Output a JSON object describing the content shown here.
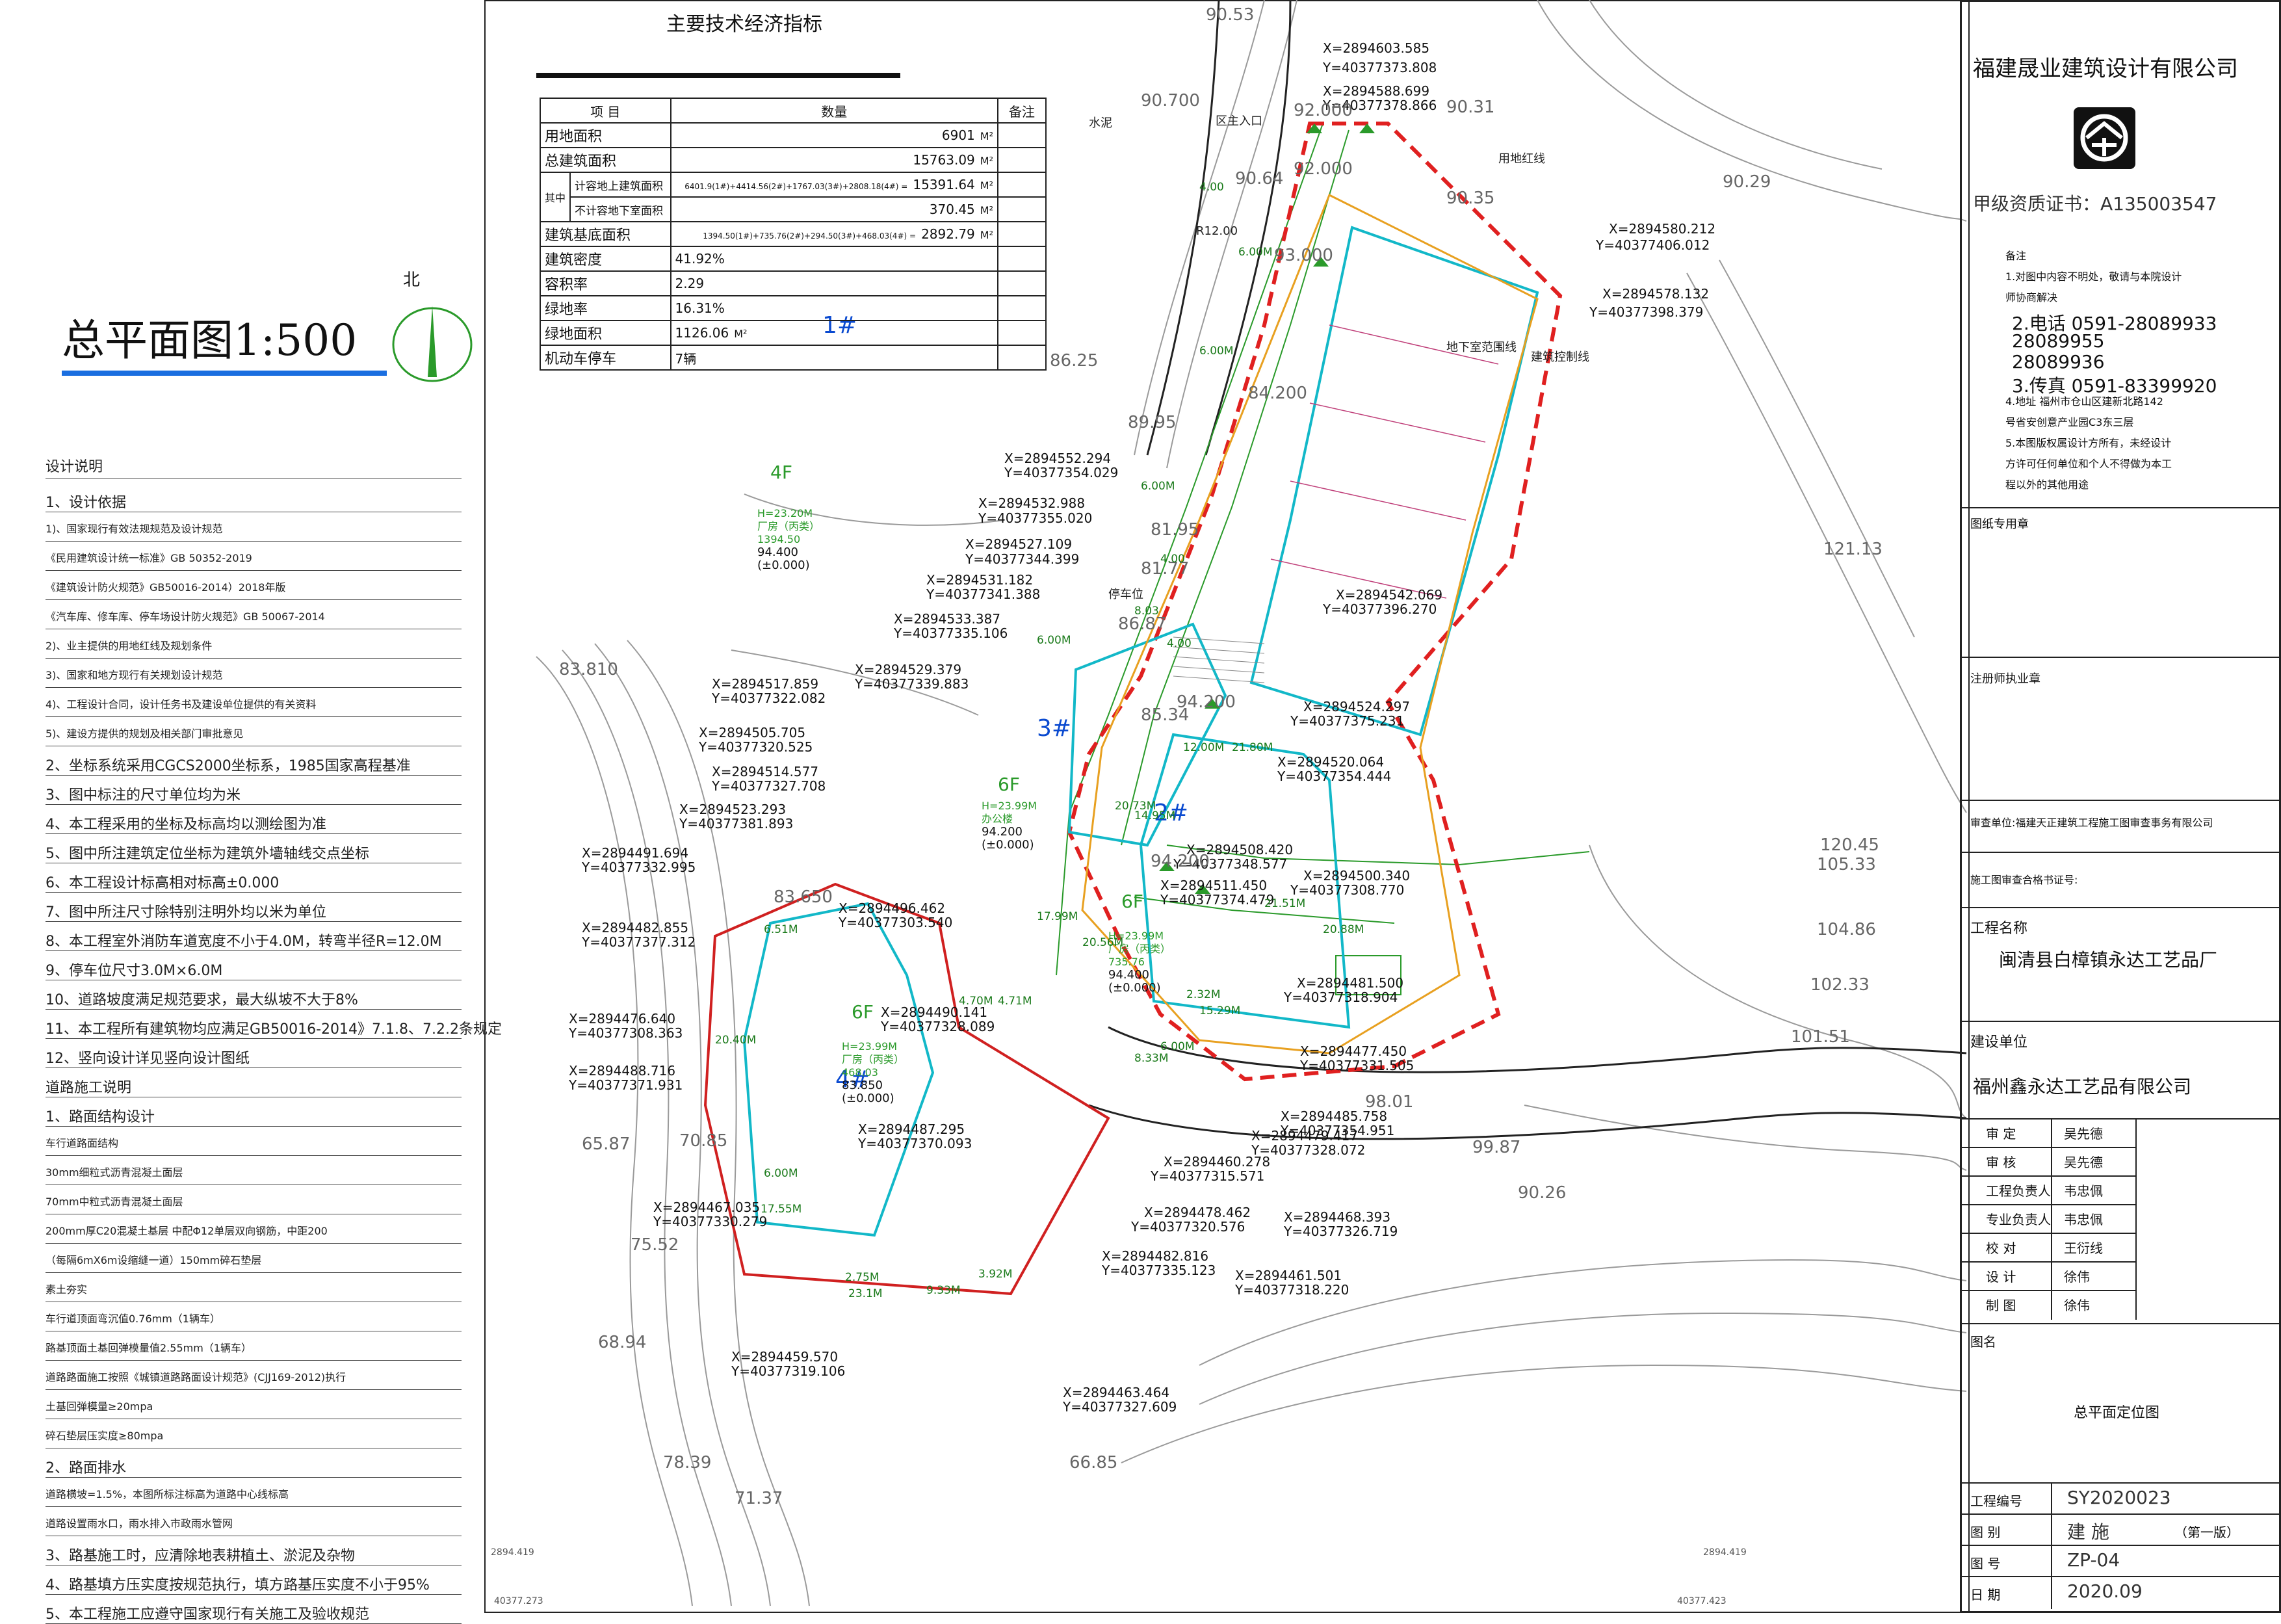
{
  "left": {
    "title": "总平面图1:500",
    "north": "北",
    "notes_heading": "设计说明",
    "notes": [
      "1、设计依据",
      "1)、国家现行有效法规规范及设计规范",
      "《民用建筑设计统一标准》GB 50352-2019",
      "《建筑设计防火规范》GB50016-2014）2018年版",
      "《汽车库、修车库、停车场设计防火规范》GB 50067-2014",
      "2)、业主提供的用地红线及规划条件",
      "3)、国家和地方现行有关规划设计规范",
      "4)、工程设计合同，设计任务书及建设单位提供的有关资料",
      "5)、建设方提供的规划及相关部门审批意见",
      "2、坐标系统采用CGCS2000坐标系，1985国家高程基准",
      "3、图中标注的尺寸单位均为米",
      "4、本工程采用的坐标及标高均以测绘图为准",
      "5、图中所注建筑定位坐标为建筑外墙轴线交点坐标",
      "6、本工程设计标高相对标高±0.000",
      "7、图中所注尺寸除特别注明外均以米为单位",
      "8、本工程室外消防车道宽度不小于4.0M，转弯半径R=12.0M",
      "9、停车位尺寸3.0M×6.0M",
      "10、道路坡度满足规范要求，最大纵坡不大于8%",
      "11、本工程所有建筑物均应满足GB50016-2014》7.1.8、7.2.2条规定",
      "12、竖向设计详见竖向设计图纸",
      "道路施工说明",
      "1、路面结构设计",
      "车行道路面结构",
      "30mm细粒式沥青混凝土面层",
      "70mm中粒式沥青混凝土面层",
      "200mm厚C20混凝土基层 中配Φ12单层双向钢筋，中距200",
      "（每隔6mX6m设缩缝一道）150mm碎石垫层",
      "素土夯实",
      "车行道顶面弯沉值0.76mm（1辆车）",
      "路基顶面土基回弹模量值2.55mm（1辆车）",
      "道路路面施工按照《城镇道路路面设计规范》(CJJ169-2012)执行",
      "土基回弹模量≥20mpa",
      "碎石垫层压实度≥80mpa",
      "2、路面排水",
      "道路横坡=1.5%，本图所标注标高为道路中心线标高",
      "道路设置雨水口，雨水排入市政雨水管网",
      "3、路基施工时，应清除地表耕植土、淤泥及杂物",
      "4、路基填方压实度按规范执行，填方路基压实度不小于95%",
      "5、本工程施工应遵守国家现行有关施工及验收规范"
    ]
  },
  "table": {
    "title": "主要技术经济指标",
    "headers": [
      "项 目",
      "数量",
      "备注"
    ],
    "rows": [
      {
        "label": "用地面积",
        "value": "6901",
        "unit": "M²"
      },
      {
        "label": "总建筑面积",
        "value": "15763.09",
        "unit": "M²"
      },
      {
        "label": "计容地上建筑面积",
        "value": "15391.64",
        "unit": "M²",
        "formula": "6401.9(1#)+4414.56(2#)+1767.03(3#)+2808.18(4#) ="
      },
      {
        "label": "不计容地下室面积",
        "value": "370.45",
        "unit": "M²"
      },
      {
        "label": "建筑基底面积",
        "value": "2892.79",
        "unit": "M²",
        "formula": "1394.50(1#)+735.76(2#)+294.50(3#)+468.03(4#) ="
      },
      {
        "label": "建筑密度",
        "value": "41.92%",
        "unit": ""
      },
      {
        "label": "容积率",
        "value": "2.29",
        "unit": ""
      },
      {
        "label": "绿地率",
        "value": "16.31%",
        "unit": ""
      },
      {
        "label": "绿地面积",
        "value": "1126.06",
        "unit": "M²"
      },
      {
        "label": "机动车停车",
        "value": "7辆",
        "unit": ""
      }
    ],
    "group_label": "其中"
  },
  "site": {
    "buildings": [
      {
        "id": "1#",
        "floors": "4F",
        "use": "厂房（丙类）",
        "height": "H=23.20M",
        "area": "1394.50",
        "elev": "94.400",
        "zero": "(±0.000)"
      },
      {
        "id": "2#",
        "floors": "6F",
        "use": "厂房（丙类）",
        "height": "H=23.99M",
        "area": "735.76",
        "elev": "94.400",
        "zero": "(±0.000)"
      },
      {
        "id": "3#",
        "floors": "6F",
        "use": "办公楼",
        "height": "H=23.99M",
        "area": "",
        "elev": "94.200",
        "zero": "(±0.000)"
      },
      {
        "id": "4#",
        "floors": "6F",
        "use": "厂房（丙类）",
        "height": "H=23.99M",
        "area": "468.03",
        "elev": "83.850",
        "zero": "(±0.000)"
      }
    ],
    "labels": {
      "redline": "用地红线",
      "buildline": "建筑控制线",
      "cement": "水泥",
      "entrance": "区主入口",
      "basement": "地下室范围线",
      "parking": "停车位",
      "road_r": "R12.00"
    },
    "coords": [
      "X=2894603.585",
      "Y=40377373.808",
      "X=2894588.699",
      "Y=40377378.866",
      "X=2894580.212",
      "Y=40377406.012",
      "X=2894578.132",
      "Y=40377398.379",
      "X=2894552.294",
      "Y=40377354.029",
      "X=2894532.988",
      "Y=40377355.020",
      "X=2894527.109",
      "Y=40377344.399",
      "X=2894531.182",
      "Y=40377341.388",
      "X=2894533.387",
      "Y=40377335.106",
      "X=2894542.069",
      "Y=40377396.270",
      "X=2894529.379",
      "Y=40377339.883",
      "X=2894517.859",
      "Y=40377322.082",
      "X=2894505.705",
      "Y=40377320.525",
      "X=2894514.577",
      "Y=40377327.708",
      "X=2894523.293",
      "Y=40377381.893",
      "X=2894524.297",
      "Y=40377375.231",
      "X=2894520.064",
      "Y=40377354.444",
      "X=2894508.420",
      "Y=40377348.577",
      "X=2894511.450",
      "Y=40377374.479",
      "X=2894500.340",
      "Y=40377308.770",
      "X=2894491.694",
      "Y=40377332.995",
      "X=2894496.462",
      "Y=40377303.540",
      "X=2894482.855",
      "Y=40377377.312",
      "X=2894481.500",
      "Y=40377318.904",
      "X=2894490.141",
      "Y=40377328.089",
      "X=2894476.640",
      "Y=40377308.363",
      "X=2894488.716",
      "Y=40377371.931",
      "X=2894477.450",
      "Y=40377331.505",
      "X=2894487.295",
      "Y=40377370.093",
      "X=2894485.758",
      "Y=40377354.951",
      "X=2894479.417",
      "Y=40377328.072",
      "X=2894460.278",
      "Y=40377315.571",
      "X=2894467.035",
      "Y=40377330.279",
      "X=2894478.462",
      "Y=40377320.576",
      "X=2894468.393",
      "Y=40377326.719",
      "X=2894482.816",
      "Y=40377335.123",
      "X=2894461.501",
      "Y=40377318.220",
      "X=2894459.570",
      "Y=40377319.106",
      "X=2894463.464",
      "Y=40377327.609"
    ],
    "elevations": [
      "90.53",
      "90.700",
      "92.000",
      "92.000",
      "93.000",
      "90.31",
      "90.35",
      "90.29",
      "90.64",
      "86.25",
      "89.95",
      "81.95",
      "81.77",
      "86.87",
      "83.810",
      "85.34",
      "84.200",
      "94.200",
      "94.200",
      "83.650",
      "121.13",
      "120.45",
      "102.33",
      "101.51",
      "104.86",
      "105.33",
      "98.01",
      "99.87",
      "90.26",
      "75.52",
      "70.85",
      "65.87",
      "68.94",
      "78.39",
      "71.37",
      "66.85"
    ],
    "dims": [
      "4.00",
      "6.00M",
      "6.00M",
      "6.00M",
      "4.00",
      "8.03",
      "6.00M",
      "12.00M",
      "21.80M",
      "20.73M",
      "14.95M",
      "17.99M",
      "20.56M",
      "21.51M",
      "20.88M",
      "15.29M",
      "8.33M",
      "4.71M",
      "2.32M",
      "6.00M",
      "6.51M",
      "20.40M",
      "17.55M",
      "6.00M",
      "23.1M",
      "2.75M",
      "9.33M",
      "3.92M",
      "4.70M",
      "4.00"
    ],
    "frame_corners": [
      "2894.419",
      "2894.419",
      "40377.273",
      "40377.423"
    ]
  },
  "titleblock": {
    "company": "福建晟业建筑设计有限公司",
    "cert": "甲级资质证书：A135003547",
    "notes": [
      "备注",
      "1.对图中内容不明处，敬请与本院设计",
      "师协商解决",
      "2.电话 0591-28089933",
      "28089955",
      "28089936",
      "3.传真 0591-83399920",
      "4.地址 福州市仓山区建新北路142",
      "号省安创意产业园C3东三层",
      "5.本图版权属设计方所有，未经设计",
      "方许可任何单位和个人不得做为本工",
      "程以外的其他用途"
    ],
    "stamp_label": "图纸专用章",
    "reg_label": "注册师执业章",
    "review_unit": "审查单位:福建天正建筑工程施工图审查事务有限公司",
    "review_no": "施工图审查合格书证号:",
    "project_label": "工程名称",
    "project": "闽清县白樟镇永达工艺品厂",
    "client_label": "建设单位",
    "client": "福州鑫永达工艺品有限公司",
    "signoff": [
      {
        "role": "审 定",
        "name": "吴先德"
      },
      {
        "role": "审 核",
        "name": "吴先德"
      },
      {
        "role": "工程负责人",
        "name": "韦忠佩"
      },
      {
        "role": "专业负责人",
        "name": "韦忠佩"
      },
      {
        "role": "校 对",
        "name": "王衍线"
      },
      {
        "role": "设 计",
        "name": "徐伟"
      },
      {
        "role": "制 图",
        "name": "徐伟"
      }
    ],
    "drawing_label": "图名",
    "drawing_name": "总平面定位图",
    "meta": [
      {
        "k": "工程编号",
        "v": "SY2020023"
      },
      {
        "k": "图 别",
        "v": "建 施",
        "extra": "（第一版）"
      },
      {
        "k": "图 号",
        "v": "ZP-04"
      },
      {
        "k": "日 期",
        "v": "2020.09"
      }
    ]
  }
}
